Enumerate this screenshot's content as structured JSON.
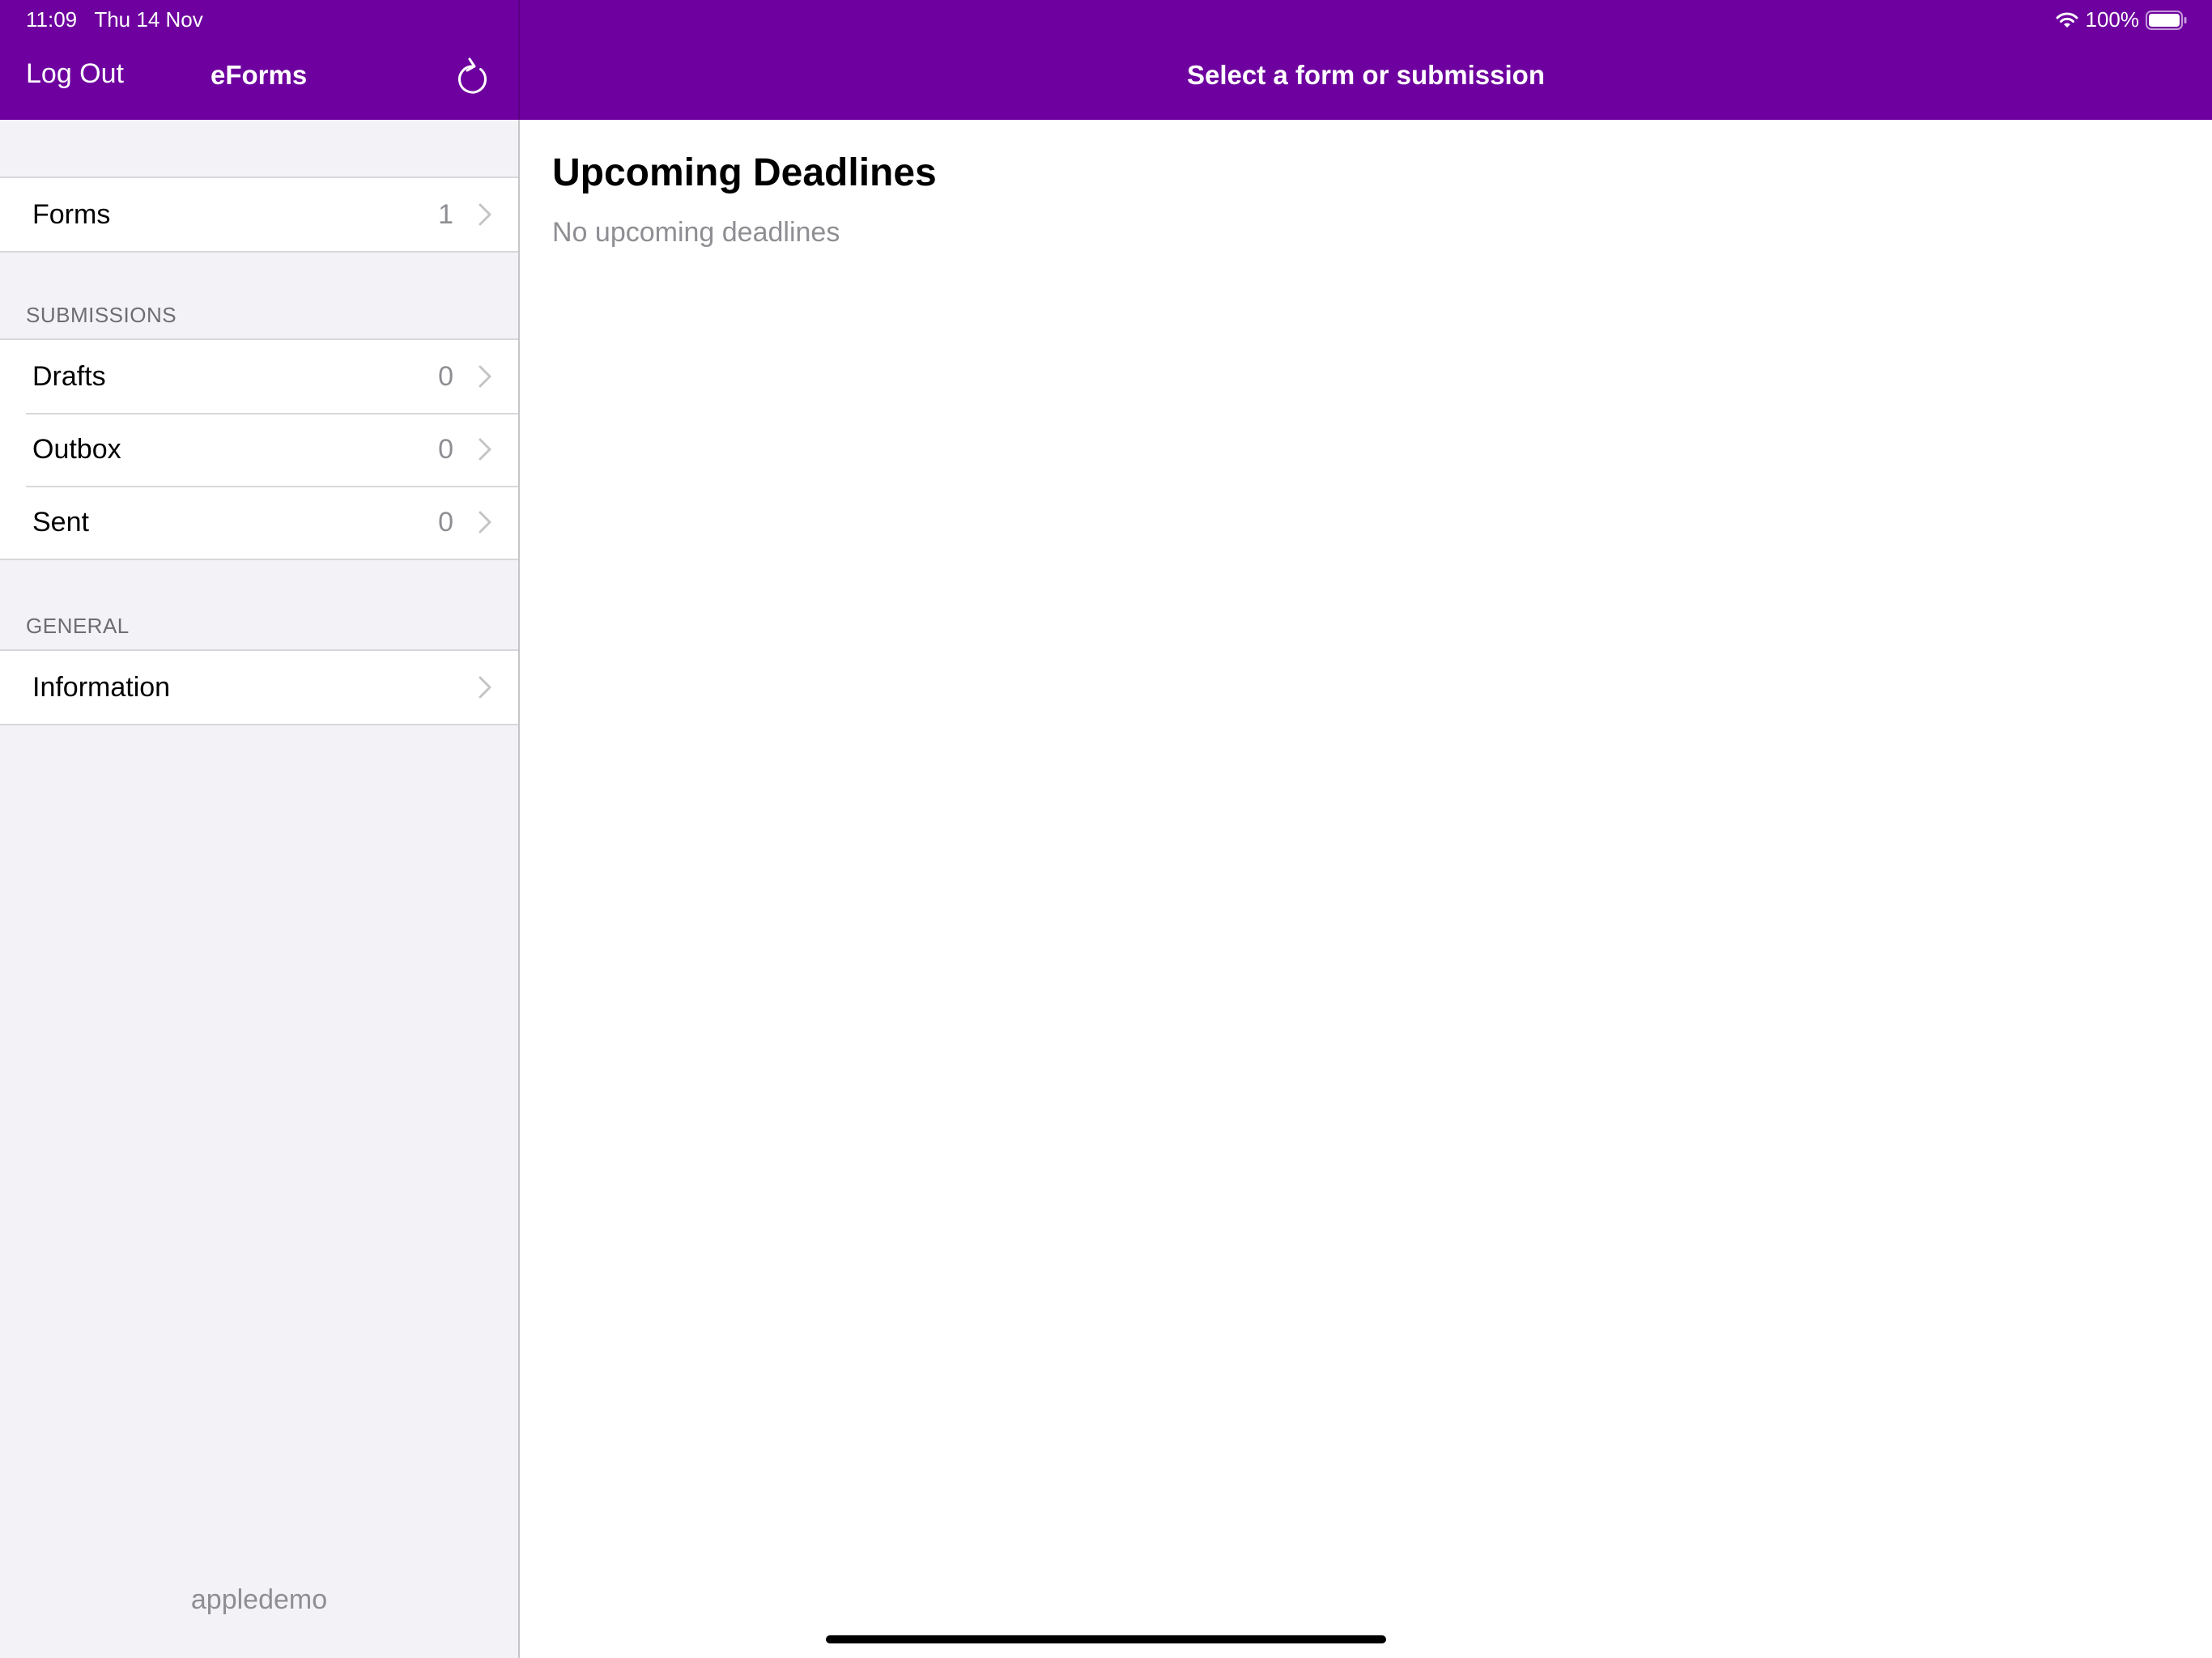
{
  "status_bar": {
    "time": "11:09",
    "date": "Thu 14 Nov",
    "battery": "100%",
    "icons": [
      "wifi-icon",
      "battery-icon"
    ]
  },
  "theme": {
    "accent": "#6e009f",
    "sidebar_bg": "#f2f2f7",
    "secondary_text": "#8e8e93"
  },
  "sidebar": {
    "logout_label": "Log Out",
    "title": "eForms",
    "refresh_icon": "refresh-icon",
    "forms": {
      "label": "Forms",
      "count": "1"
    },
    "submissions": {
      "header": "SUBMISSIONS",
      "items": [
        {
          "label": "Drafts",
          "count": "0"
        },
        {
          "label": "Outbox",
          "count": "0"
        },
        {
          "label": "Sent",
          "count": "0"
        }
      ]
    },
    "general": {
      "header": "GENERAL",
      "items": [
        {
          "label": "Information"
        }
      ]
    },
    "account_name": "appledemo"
  },
  "detail": {
    "title": "Select a form or submission",
    "deadlines_heading": "Upcoming Deadlines",
    "deadlines_empty": "No upcoming deadlines"
  }
}
